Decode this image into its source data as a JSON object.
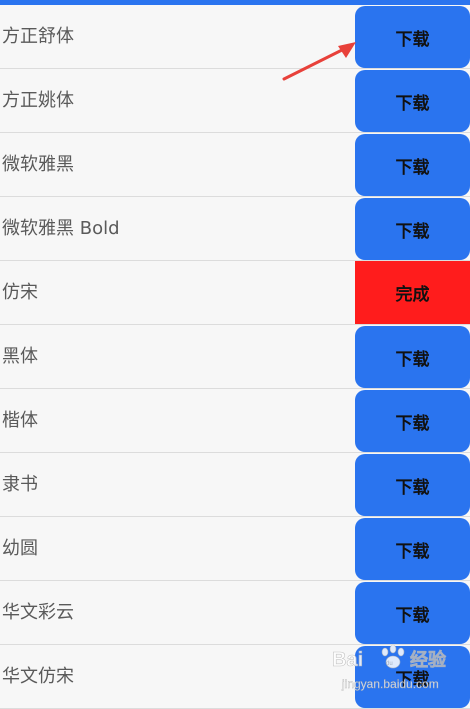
{
  "colors": {
    "topbar": "#2a74ef",
    "download_button": "#2a74ef",
    "done_button": "#ff1c1c",
    "arrow": "#e8413a",
    "watermark": "#ffffff"
  },
  "fonts": [
    {
      "name": "方正舒体",
      "button": "下载",
      "state": "download"
    },
    {
      "name": "方正姚体",
      "button": "下载",
      "state": "download"
    },
    {
      "name": "微软雅黑",
      "button": "下载",
      "state": "download"
    },
    {
      "name": "微软雅黑 Bold",
      "button": "下载",
      "state": "download"
    },
    {
      "name": "仿宋",
      "button": "完成",
      "state": "done"
    },
    {
      "name": "黑体",
      "button": "下载",
      "state": "download"
    },
    {
      "name": "楷体",
      "button": "下载",
      "state": "download"
    },
    {
      "name": "隶书",
      "button": "下载",
      "state": "download"
    },
    {
      "name": "幼圆",
      "button": "下载",
      "state": "download"
    },
    {
      "name": "华文彩云",
      "button": "下载",
      "state": "download"
    },
    {
      "name": "华文仿宋",
      "button": "下载",
      "state": "download"
    }
  ],
  "watermark": {
    "brand": "Bai",
    "paw": "du",
    "label": "经验",
    "url": "jingyan.baidu.com"
  },
  "annotation": {
    "icon": "red-arrow-icon"
  }
}
